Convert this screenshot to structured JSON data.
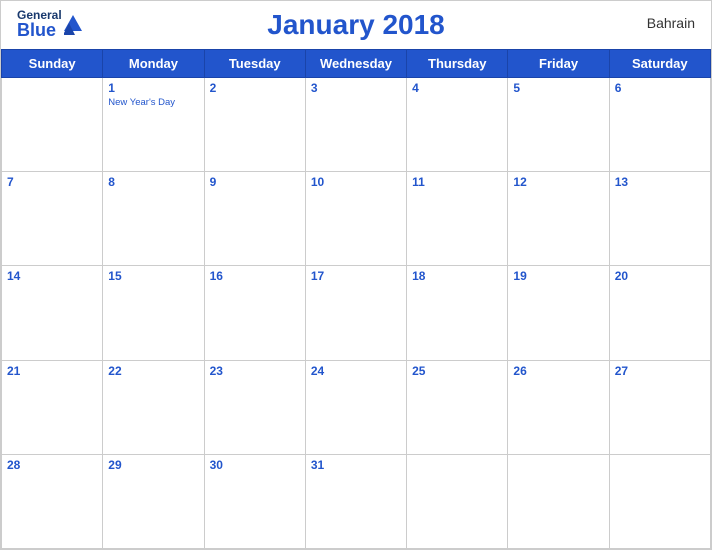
{
  "header": {
    "logo": {
      "general": "General",
      "blue": "Blue"
    },
    "title": "January 2018",
    "country": "Bahrain"
  },
  "weekdays": [
    "Sunday",
    "Monday",
    "Tuesday",
    "Wednesday",
    "Thursday",
    "Friday",
    "Saturday"
  ],
  "weeks": [
    [
      {
        "day": "",
        "holiday": ""
      },
      {
        "day": "1",
        "holiday": "New Year's Day"
      },
      {
        "day": "2",
        "holiday": ""
      },
      {
        "day": "3",
        "holiday": ""
      },
      {
        "day": "4",
        "holiday": ""
      },
      {
        "day": "5",
        "holiday": ""
      },
      {
        "day": "6",
        "holiday": ""
      }
    ],
    [
      {
        "day": "7",
        "holiday": ""
      },
      {
        "day": "8",
        "holiday": ""
      },
      {
        "day": "9",
        "holiday": ""
      },
      {
        "day": "10",
        "holiday": ""
      },
      {
        "day": "11",
        "holiday": ""
      },
      {
        "day": "12",
        "holiday": ""
      },
      {
        "day": "13",
        "holiday": ""
      }
    ],
    [
      {
        "day": "14",
        "holiday": ""
      },
      {
        "day": "15",
        "holiday": ""
      },
      {
        "day": "16",
        "holiday": ""
      },
      {
        "day": "17",
        "holiday": ""
      },
      {
        "day": "18",
        "holiday": ""
      },
      {
        "day": "19",
        "holiday": ""
      },
      {
        "day": "20",
        "holiday": ""
      }
    ],
    [
      {
        "day": "21",
        "holiday": ""
      },
      {
        "day": "22",
        "holiday": ""
      },
      {
        "day": "23",
        "holiday": ""
      },
      {
        "day": "24",
        "holiday": ""
      },
      {
        "day": "25",
        "holiday": ""
      },
      {
        "day": "26",
        "holiday": ""
      },
      {
        "day": "27",
        "holiday": ""
      }
    ],
    [
      {
        "day": "28",
        "holiday": ""
      },
      {
        "day": "29",
        "holiday": ""
      },
      {
        "day": "30",
        "holiday": ""
      },
      {
        "day": "31",
        "holiday": ""
      },
      {
        "day": "",
        "holiday": ""
      },
      {
        "day": "",
        "holiday": ""
      },
      {
        "day": "",
        "holiday": ""
      }
    ]
  ]
}
